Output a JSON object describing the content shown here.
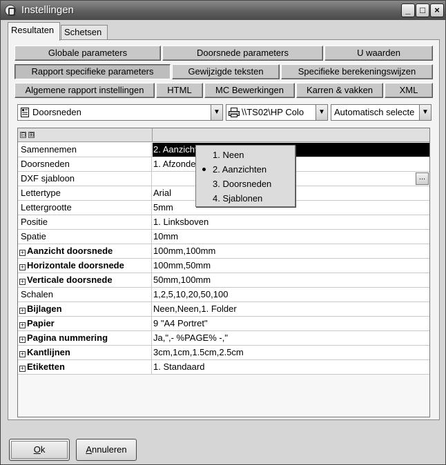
{
  "window": {
    "title": "Instellingen",
    "controls": {
      "minimize": "_",
      "maximize": "□",
      "close": "×"
    }
  },
  "tabs": [
    {
      "label": "Resultaten",
      "active": true
    },
    {
      "label": "Schetsen",
      "active": false
    }
  ],
  "button_rows": [
    [
      "Globale parameters",
      "Doorsnede parameters",
      "U waarden"
    ],
    [
      "Rapport specifieke parameters",
      "Gewijzigde teksten",
      "Specifieke berekeningswijzen"
    ],
    [
      "Algemene rapport instellingen",
      "HTML",
      "MC Bewerkingen",
      "Karren & vakken",
      "XML"
    ]
  ],
  "selectors": {
    "report": {
      "value": "Doorsneden",
      "icon": "report-icon"
    },
    "printer": {
      "value": "\\\\TS02\\HP Colo",
      "icon": "printer-icon"
    },
    "paper": {
      "value": "Automatisch selecte"
    }
  },
  "grid": {
    "header_controls": [
      "⊟",
      "⊞"
    ],
    "rows": [
      {
        "name": "Samennemen",
        "value": "2. Aanzichten",
        "bold": false,
        "expandable": false,
        "selected": true
      },
      {
        "name": "Doorsneden",
        "value": "1. Afzonderlijk",
        "bold": false,
        "expandable": false
      },
      {
        "name": "DXF sjabloon",
        "value": "",
        "bold": false,
        "expandable": false,
        "has_browse": true
      },
      {
        "name": "Lettertype",
        "value": "Arial",
        "bold": false,
        "expandable": false
      },
      {
        "name": "Lettergrootte",
        "value": "5mm",
        "bold": false,
        "expandable": false
      },
      {
        "name": "Positie",
        "value": "1. Linksboven",
        "bold": false,
        "expandable": false
      },
      {
        "name": "Spatie",
        "value": "10mm",
        "bold": false,
        "expandable": false
      },
      {
        "name": "Aanzicht doorsnede",
        "value": "100mm,100mm",
        "bold": true,
        "expandable": true
      },
      {
        "name": "Horizontale doorsnede",
        "value": "100mm,50mm",
        "bold": true,
        "expandable": true
      },
      {
        "name": "Verticale doorsnede",
        "value": "50mm,100mm",
        "bold": true,
        "expandable": true
      },
      {
        "name": "Schalen",
        "value": "1,2,5,10,20,50,100",
        "bold": false,
        "expandable": false
      },
      {
        "name": "Bijlagen",
        "value": "Neen,Neen,1. Folder",
        "bold": true,
        "expandable": true
      },
      {
        "name": "Papier",
        "value": "9 \"A4 Portret\"",
        "bold": true,
        "expandable": true
      },
      {
        "name": "Pagina nummering",
        "value": "Ja,\",- %PAGE% -,\"",
        "bold": true,
        "expandable": true
      },
      {
        "name": "Kantlijnen",
        "value": "3cm,1cm,1.5cm,2.5cm",
        "bold": true,
        "expandable": true
      },
      {
        "name": "Etiketten",
        "value": "1. Standaard",
        "bold": true,
        "expandable": true
      }
    ],
    "browse_label": "..."
  },
  "dropdown": {
    "options": [
      "1. Neen",
      "2. Aanzichten",
      "3. Doorsneden",
      "4. Sjablonen"
    ],
    "selected_index": 1
  },
  "footer": {
    "ok": {
      "underline": "O",
      "rest": "k"
    },
    "cancel": {
      "underline": "A",
      "rest": "nnuleren"
    }
  }
}
